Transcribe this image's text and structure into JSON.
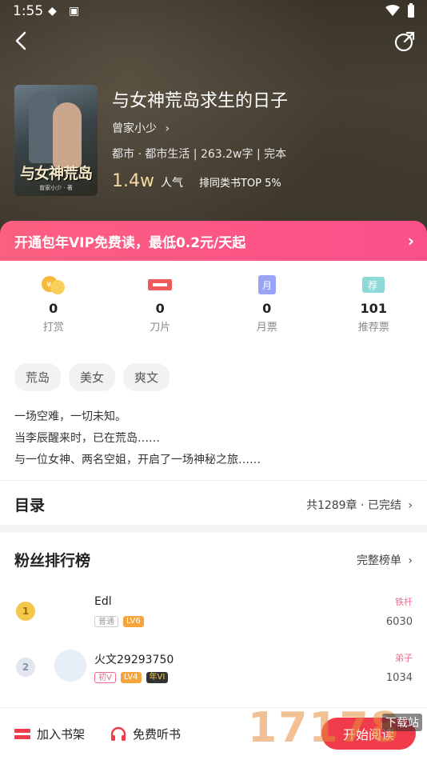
{
  "status": {
    "time": "1:55"
  },
  "book": {
    "title": "与女神荒岛求生的日子",
    "author": "曾家小少",
    "meta": "都市 · 都市生活 | 263.2w字 | 完本",
    "popularity": "1.4w",
    "popularity_label": "人气",
    "rank": "排同类书TOP 5%",
    "cover_title": "与女神荒岛",
    "cover_author": "曾家小少 · 著"
  },
  "vip": {
    "text": "开通包年VIP免费读，最低0.2元/天起"
  },
  "stats": [
    {
      "value": "0",
      "label": "打赏",
      "icon": "coin-icon"
    },
    {
      "value": "0",
      "label": "刀片",
      "icon": "blade-icon"
    },
    {
      "value": "0",
      "label": "月票",
      "icon": "monthly-ticket-icon"
    },
    {
      "value": "101",
      "label": "推荐票",
      "icon": "recommend-ticket-icon"
    }
  ],
  "tags": [
    "荒岛",
    "美女",
    "爽文"
  ],
  "description": [
    "一场空难，一切未知。",
    "当李辰醒来时，已在荒岛……",
    "与一位女神、两名空姐，开启了一场神秘之旅……"
  ],
  "toc": {
    "title": "目录",
    "summary": "共1289章 · 已完结"
  },
  "fans": {
    "title": "粉丝排行榜",
    "link": "完整榜单",
    "items": [
      {
        "rank": "1",
        "name": "Edl",
        "badges": [
          "普通",
          "LV6"
        ],
        "level": "铁杆",
        "score": "6030"
      },
      {
        "rank": "2",
        "name": "火文29293750",
        "badges": [
          "初V",
          "LV4",
          "年VI"
        ],
        "level": "弟子",
        "score": "1034"
      }
    ]
  },
  "bottom": {
    "add_shelf": "加入书架",
    "listen": "免费听书",
    "read": "开始阅读"
  },
  "watermark": {
    "text": "17178",
    "sub": "下载站"
  }
}
